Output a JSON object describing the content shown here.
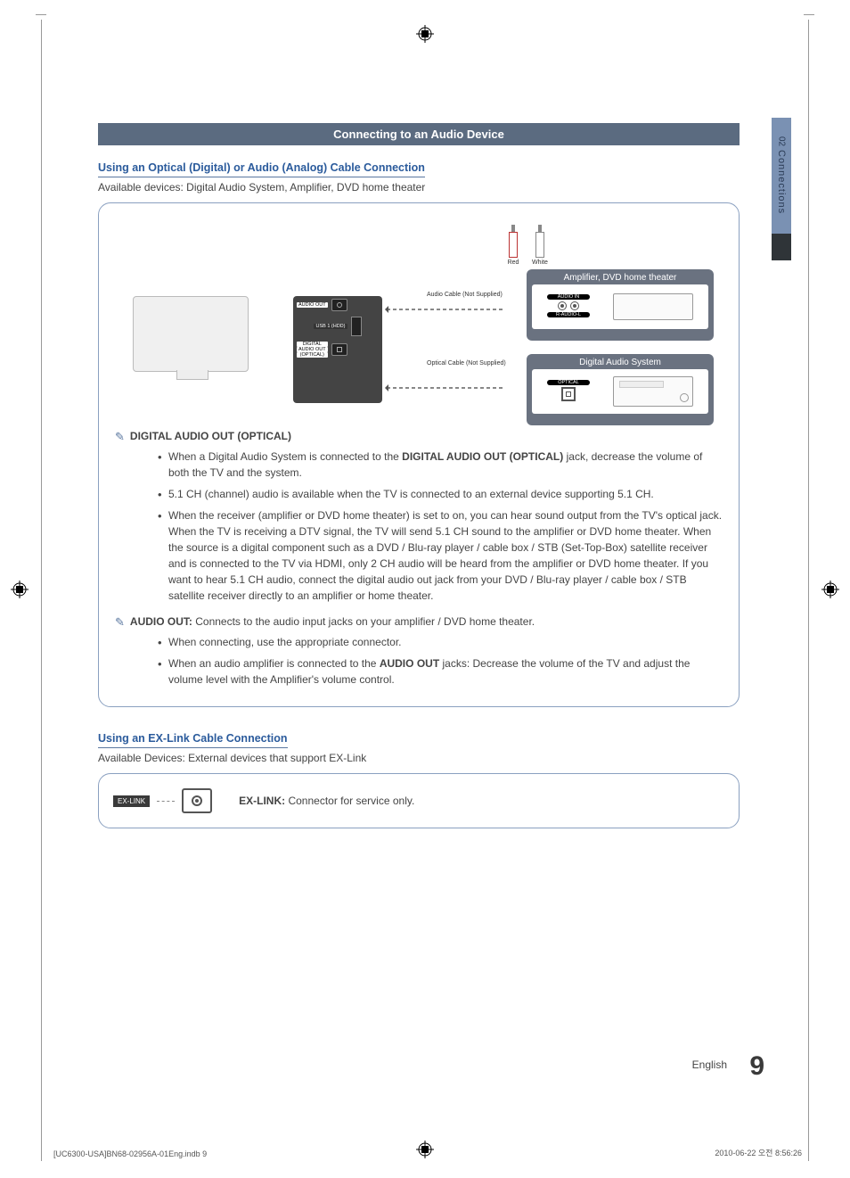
{
  "sidebar": {
    "number": "02",
    "label": "Connections"
  },
  "sectionBar": "Connecting to an Audio Device",
  "opticalSection": {
    "heading": "Using an Optical (Digital) or Audio (Analog) Cable Connection",
    "available": "Available devices: Digital Audio System, Amplifier, DVD home theater"
  },
  "diagram": {
    "rcaRed": "Red",
    "rcaWhite": "White",
    "audioCable": "Audio Cable (Not Supplied)",
    "opticalCable": "Optical Cable (Not Supplied)",
    "ampTitle": "Amplifier, DVD home theater",
    "dasTitle": "Digital Audio System",
    "audioIn": "AUDIO IN",
    "audioInSub": "R-AUDIO-L",
    "optical": "OPTICAL",
    "portAudioOut": "AUDIO OUT",
    "portUsb": "USB 1 (HDD)",
    "portDigital1": "DIGITAL",
    "portDigital2": "AUDIO OUT",
    "portDigital3": "(OPTICAL)"
  },
  "notes": {
    "digitalHead": "DIGITAL AUDIO OUT (OPTICAL)",
    "d1a": "When a Digital Audio System is connected to the ",
    "d1b": "DIGITAL AUDIO OUT (OPTICAL)",
    "d1c": " jack, decrease the volume of both the TV and the system.",
    "d2": "5.1 CH (channel) audio is available when the TV is connected to an external device supporting 5.1 CH.",
    "d3": "When the receiver (amplifier or DVD home theater) is set to on, you can hear sound output from the TV's optical jack. When the TV is receiving a DTV signal, the TV will send 5.1 CH sound to the amplifier or DVD home theater. When the source is a digital component such as a DVD / Blu-ray player / cable box / STB (Set-Top-Box) satellite receiver and is connected to the TV via HDMI, only 2 CH audio will be heard from the amplifier or DVD home theater. If you want to hear 5.1 CH audio, connect the digital audio out jack from your DVD / Blu-ray player / cable box / STB satellite receiver directly to an amplifier or home theater.",
    "audioHead": "AUDIO OUT:",
    "audioHeadRest": " Connects to the audio input jacks on your amplifier / DVD home theater.",
    "a1": "When connecting, use the appropriate connector.",
    "a2a": "When an audio amplifier is connected to the ",
    "a2b": "AUDIO OUT",
    "a2c": " jacks: Decrease the volume of the TV and adjust the volume level with the Amplifier's volume control."
  },
  "exlink": {
    "heading": "Using an EX-Link Cable Connection",
    "available": "Available Devices: External devices that support EX-Link",
    "tag": "EX-LINK",
    "descHead": "EX-LINK:",
    "descRest": " Connector for service only."
  },
  "footer": {
    "lang": "English",
    "page": "9",
    "file": "[UC6300-USA]BN68-02956A-01Eng.indb   9",
    "time": "2010-06-22   오전 8:56:26"
  }
}
